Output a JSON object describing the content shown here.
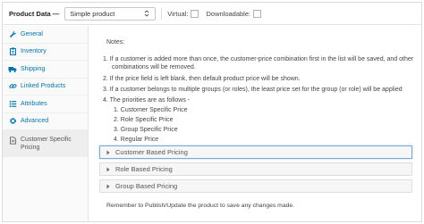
{
  "header": {
    "title": "Product Data —",
    "product_type": "Simple product",
    "virtual_label": "Virtual:",
    "downloadable_label": "Downloadable:"
  },
  "sidebar": {
    "items": [
      {
        "label": "General",
        "icon": "wrench-icon"
      },
      {
        "label": "Inventory",
        "icon": "clipboard-icon"
      },
      {
        "label": "Shipping",
        "icon": "truck-icon"
      },
      {
        "label": "Linked Products",
        "icon": "link-icon"
      },
      {
        "label": "Attributes",
        "icon": "list-icon"
      },
      {
        "label": "Advanced",
        "icon": "gear-icon"
      },
      {
        "label": "Customer Specific Pricing",
        "icon": "document-icon"
      }
    ]
  },
  "notes": {
    "title": "Notes:",
    "line1a": "1.  If a customer is added more than once, the customer-price combination first in the list will be saved, and other",
    "line1b": "combinations will be removed.",
    "line2": "2.  If the price field is left blank, then default product price will be shown.",
    "line3": "3.  If a customer belongs to multiple groups (or roles), the least price set for the group (or role) will be applied",
    "line4": "4.  The priorities are as follows -",
    "priorities": [
      "1.  Customer Specific Price",
      "2.  Role Specific Price",
      "3.  Group Specific Price",
      "4.  Regular Price"
    ]
  },
  "accordion": [
    {
      "label": "Customer Based Pricing",
      "selected": true
    },
    {
      "label": "Role Based Pricing",
      "selected": false
    },
    {
      "label": "Group Based Pricing",
      "selected": false
    }
  ],
  "footer_note": "Remember to Publish/Update the product to save any changes made.",
  "colors": {
    "link": "#0073aa",
    "border": "#dcdcdc",
    "active_tab": "#eeeeee",
    "focus": "#7ba8d4"
  }
}
